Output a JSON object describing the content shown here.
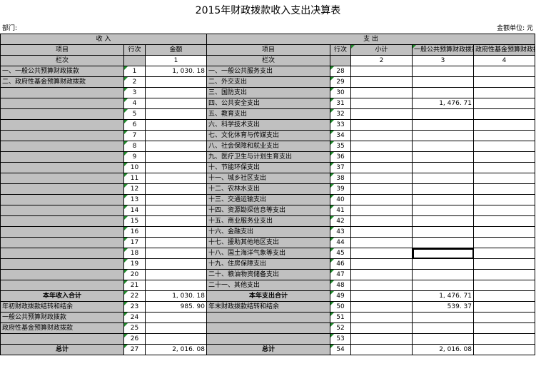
{
  "title": "2015年财政拨款收入支出决算表",
  "department_label": "部门:",
  "unit_label": "金额单位: 元",
  "headers": {
    "income_group": "收    入",
    "expense_group": "支    出",
    "item": "项目",
    "line_no": "行次",
    "amount": "金额",
    "expense_item": "项目",
    "expense_line_no": "行次",
    "subtotal": "小计",
    "general_budget": "一般公共预算财政拨款",
    "fund_budget": "政府性基金预算财政拨款",
    "col_label": "栏次",
    "col1": "1",
    "col_label2": "栏次",
    "col2": "2",
    "col3": "3",
    "col4": "4"
  },
  "rows": [
    {
      "in_item": "一、一般公共预算财政拨款",
      "in_no": "1",
      "in_amt": "1, 030. 18",
      "ex_item": "一、一般公共服务支出",
      "ex_no": "28",
      "sub": "",
      "gen": "",
      "fund": ""
    },
    {
      "in_item": "二、政府性基金预算财政拨款",
      "in_no": "2",
      "in_amt": "",
      "ex_item": "二、外交支出",
      "ex_no": "29",
      "sub": "",
      "gen": "",
      "fund": ""
    },
    {
      "in_item": "",
      "in_no": "3",
      "in_amt": "",
      "ex_item": "三、国防支出",
      "ex_no": "30",
      "sub": "",
      "gen": "",
      "fund": ""
    },
    {
      "in_item": "",
      "in_no": "4",
      "in_amt": "",
      "ex_item": "四、公共安全支出",
      "ex_no": "31",
      "sub": "",
      "gen": "1, 476. 71",
      "fund": ""
    },
    {
      "in_item": "",
      "in_no": "5",
      "in_amt": "",
      "ex_item": "五、教育支出",
      "ex_no": "32",
      "sub": "",
      "gen": "",
      "fund": ""
    },
    {
      "in_item": "",
      "in_no": "6",
      "in_amt": "",
      "ex_item": "六、科学技术支出",
      "ex_no": "33",
      "sub": "",
      "gen": "",
      "fund": ""
    },
    {
      "in_item": "",
      "in_no": "7",
      "in_amt": "",
      "ex_item": "七、文化体育与传媒支出",
      "ex_no": "34",
      "sub": "",
      "gen": "",
      "fund": ""
    },
    {
      "in_item": "",
      "in_no": "8",
      "in_amt": "",
      "ex_item": "八、社会保障和就业支出",
      "ex_no": "35",
      "sub": "",
      "gen": "",
      "fund": ""
    },
    {
      "in_item": "",
      "in_no": "9",
      "in_amt": "",
      "ex_item": "九、医疗卫生与计划生育支出",
      "ex_no": "36",
      "sub": "",
      "gen": "",
      "fund": ""
    },
    {
      "in_item": "",
      "in_no": "10",
      "in_amt": "",
      "ex_item": "十、节能环保支出",
      "ex_no": "37",
      "sub": "",
      "gen": "",
      "fund": ""
    },
    {
      "in_item": "",
      "in_no": "11",
      "in_amt": "",
      "ex_item": "十一、城乡社区支出",
      "ex_no": "38",
      "sub": "",
      "gen": "",
      "fund": ""
    },
    {
      "in_item": "",
      "in_no": "12",
      "in_amt": "",
      "ex_item": "十二、农林水支出",
      "ex_no": "39",
      "sub": "",
      "gen": "",
      "fund": ""
    },
    {
      "in_item": "",
      "in_no": "13",
      "in_amt": "",
      "ex_item": "十三、交通运输支出",
      "ex_no": "40",
      "sub": "",
      "gen": "",
      "fund": ""
    },
    {
      "in_item": "",
      "in_no": "14",
      "in_amt": "",
      "ex_item": "十四、资源勘探信息等支出",
      "ex_no": "41",
      "sub": "",
      "gen": "",
      "fund": ""
    },
    {
      "in_item": "",
      "in_no": "15",
      "in_amt": "",
      "ex_item": "十五、商业服务业支出",
      "ex_no": "42",
      "sub": "",
      "gen": "",
      "fund": ""
    },
    {
      "in_item": "",
      "in_no": "16",
      "in_amt": "",
      "ex_item": "十六、金融支出",
      "ex_no": "43",
      "sub": "",
      "gen": "",
      "fund": ""
    },
    {
      "in_item": "",
      "in_no": "17",
      "in_amt": "",
      "ex_item": "十七、援助其他地区支出",
      "ex_no": "44",
      "sub": "",
      "gen": "",
      "fund": ""
    },
    {
      "in_item": "",
      "in_no": "18",
      "in_amt": "",
      "ex_item": "十八、国土海洋气象等支出",
      "ex_no": "45",
      "sub": "",
      "gen": "",
      "fund": ""
    },
    {
      "in_item": "",
      "in_no": "19",
      "in_amt": "",
      "ex_item": "十九、住房保障支出",
      "ex_no": "46",
      "sub": "",
      "gen": "",
      "fund": ""
    },
    {
      "in_item": "",
      "in_no": "20",
      "in_amt": "",
      "ex_item": "二十、粮油物资储备支出",
      "ex_no": "47",
      "sub": "",
      "gen": "",
      "fund": ""
    },
    {
      "in_item": "",
      "in_no": "21",
      "in_amt": "",
      "ex_item": "二十一、其他支出",
      "ex_no": "48",
      "sub": "",
      "gen": "",
      "fund": ""
    },
    {
      "in_item": "本年收入合计",
      "in_no": "22",
      "in_amt": "1, 030. 18",
      "ex_item": "本年支出合计",
      "ex_no": "49",
      "sub": "",
      "gen": "1, 476. 71",
      "fund": "",
      "bold": true
    },
    {
      "in_item": "年初财政拨款结转和结余",
      "in_no": "23",
      "in_amt": "985. 90",
      "ex_item": "年末财政拨款结转和结余",
      "ex_no": "50",
      "sub": "",
      "gen": "539. 37",
      "fund": ""
    },
    {
      "in_item": "一般公共预算财政拨款",
      "in_no": "24",
      "in_amt": "",
      "ex_item": "",
      "ex_no": "51",
      "sub": "",
      "gen": "",
      "fund": "",
      "indent": true
    },
    {
      "in_item": "政府性基金预算财政拨款",
      "in_no": "25",
      "in_amt": "",
      "ex_item": "",
      "ex_no": "52",
      "sub": "",
      "gen": "",
      "fund": "",
      "indent": true
    },
    {
      "in_item": "",
      "in_no": "26",
      "in_amt": "",
      "ex_item": "",
      "ex_no": "53",
      "sub": "",
      "gen": "",
      "fund": ""
    },
    {
      "in_item": "总计",
      "in_no": "27",
      "in_amt": "2, 016. 08",
      "ex_item": "总计",
      "ex_no": "54",
      "sub": "",
      "gen": "2, 016. 08",
      "fund": "",
      "bold": true
    }
  ]
}
